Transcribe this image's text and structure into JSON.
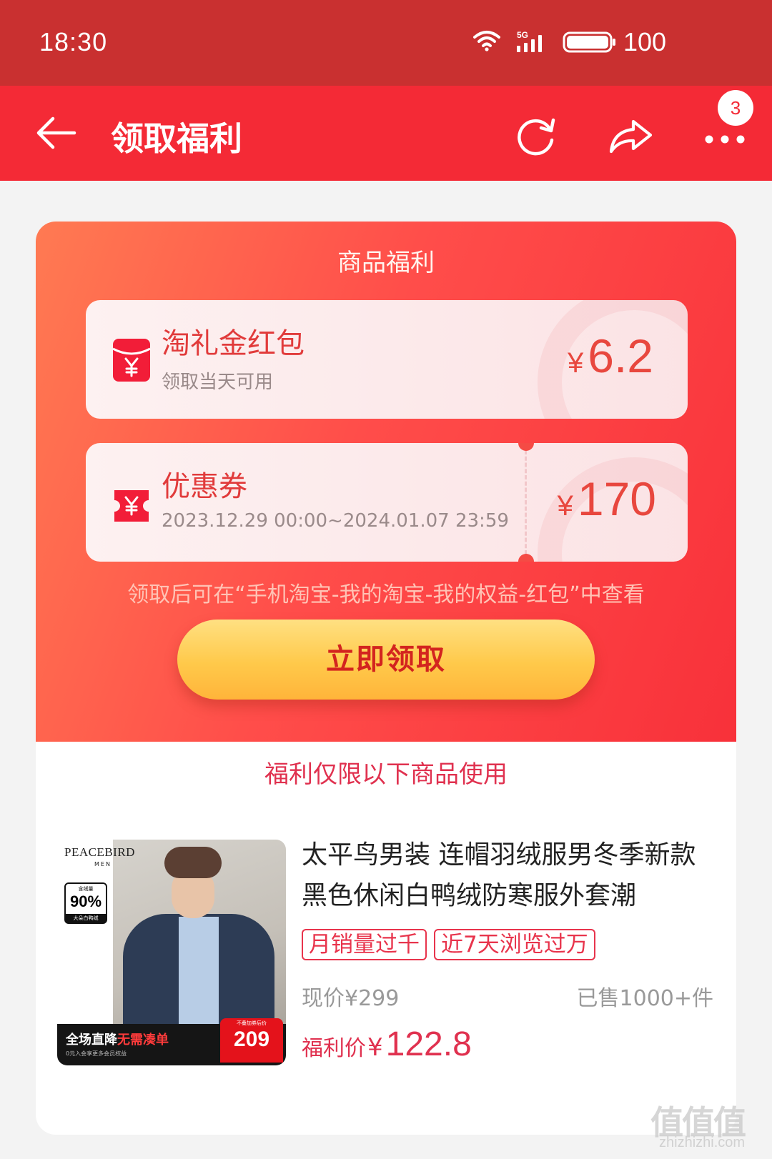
{
  "status_bar": {
    "time": "18:30",
    "network": "5G",
    "battery": "100",
    "icons": [
      "wifi-icon",
      "signal-icon",
      "battery-icon"
    ]
  },
  "navbar": {
    "title": "领取福利",
    "badge_count": "3",
    "icons": [
      "back-arrow-icon",
      "refresh-icon",
      "share-icon",
      "more-icon"
    ]
  },
  "benefits": {
    "section_title": "商品福利",
    "items": [
      {
        "name": "淘礼金红包",
        "subtitle": "领取当天可用",
        "currency": "¥",
        "amount": "6.2",
        "icon": "red-envelope-icon"
      },
      {
        "name": "优惠券",
        "subtitle": "2023.12.29 00:00~2024.01.07 23:59",
        "currency": "¥",
        "amount": "170",
        "icon": "coupon-icon"
      }
    ],
    "hint": "领取后可在“手机淘宝-我的淘宝-我的权益-红包”中查看",
    "claim_button": "立即领取"
  },
  "products": {
    "limit_title": "福利仅限以下商品使用",
    "item": {
      "image": {
        "brand": "PEACEBIRD",
        "brand_sub": "MEN",
        "badge_top": "含绒量",
        "badge_value": "90%",
        "badge_bottom": "大朵白鸭绒",
        "banner_text": "全场直降",
        "banner_highlight": "无需凑单",
        "banner_sub": "0元入会享更多会员权益",
        "price_tag_top": "不叠加券后价",
        "price_tag_value": "209"
      },
      "title": "太平鸟男装 连帽羽绒服男冬季新款黑色休闲白鸭绒防寒服外套潮",
      "tags": [
        "月销量过千",
        "近7天浏览过万"
      ],
      "current_price_label": "现价",
      "current_price": "¥299",
      "sold": "已售1000+件",
      "benefit_price_label": "福利价",
      "benefit_price_currency": "¥",
      "benefit_price": "122.8"
    }
  },
  "watermark": {
    "text": "值值值",
    "url": "zhizhizhi.com"
  },
  "colors": {
    "status_bar": "#c93030",
    "nav_bar": "#f42a36",
    "accent_red": "#e0314f",
    "button_yellow": "#ffc94a"
  }
}
